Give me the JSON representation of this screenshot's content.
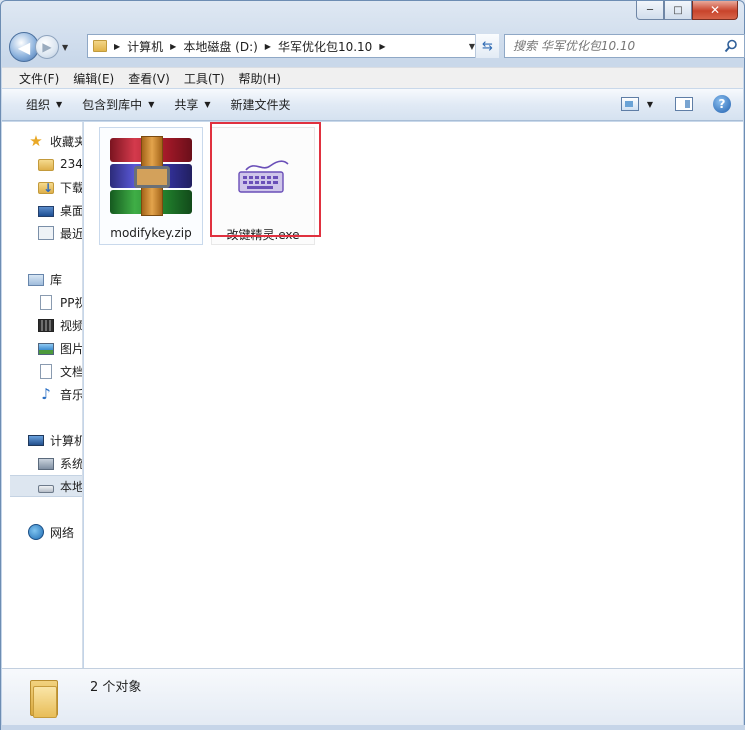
{
  "window": {
    "minimize_glyph": "─",
    "maximize_glyph": "□",
    "close_glyph": "✕"
  },
  "address": {
    "crumbs": [
      "计算机",
      "本地磁盘 (D:)",
      "华军优化包10.10"
    ]
  },
  "search": {
    "placeholder": "搜索 华军优化包10.10"
  },
  "menu": {
    "items": [
      "文件(F)",
      "编辑(E)",
      "查看(V)",
      "工具(T)",
      "帮助(H)"
    ]
  },
  "toolbar": {
    "organize": "组织",
    "include_in_library": "包含到库中",
    "share": "共享",
    "new_folder": "新建文件夹",
    "help_glyph": "?"
  },
  "navpane": {
    "items": [
      {
        "label": "收藏夹",
        "icon": "star-icon"
      },
      {
        "label": "234",
        "icon": "folder-icon"
      },
      {
        "label": "下载",
        "icon": "downloads-folder-icon"
      },
      {
        "label": "桌面",
        "icon": "desktop-icon"
      },
      {
        "label": "最近",
        "icon": "recent-places-icon"
      },
      {
        "label": "库",
        "icon": "library-icon"
      },
      {
        "label": "PP视",
        "icon": "document-icon"
      },
      {
        "label": "视频",
        "icon": "video-icon"
      },
      {
        "label": "图片",
        "icon": "pictures-icon"
      },
      {
        "label": "文档",
        "icon": "document-icon"
      },
      {
        "label": "音乐",
        "icon": "music-icon"
      },
      {
        "label": "计算机",
        "icon": "computer-icon"
      },
      {
        "label": "系统",
        "icon": "system-drive-icon"
      },
      {
        "label": "本地",
        "icon": "local-drive-icon"
      },
      {
        "label": "网络",
        "icon": "network-icon"
      }
    ],
    "selected_label": "本地"
  },
  "files": [
    {
      "name": "modifykey.zip",
      "icon": "winrar-archive-icon"
    },
    {
      "name": "改键精灵.exe",
      "icon": "keyboard-app-icon"
    }
  ],
  "status": {
    "item_count": "2 个对象"
  },
  "colors": {
    "highlight_box": "#e0313f",
    "selection": "#dde6f0"
  }
}
